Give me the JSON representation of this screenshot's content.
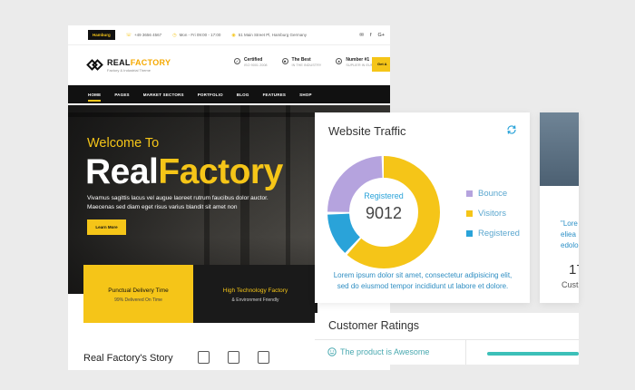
{
  "site": {
    "topbar": {
      "location": "Hamburg",
      "phone": "+49 3656 4567",
      "hours": "Mon - Fri 09:00 - 17:00",
      "address": "51 Main Street Pl, Hamburg Germany",
      "social": [
        "✉",
        "f",
        "G+"
      ]
    },
    "brand": {
      "real": "REAL",
      "factory": "FACTORY",
      "tagline": "Factory & Industrial Theme"
    },
    "header_info": [
      {
        "title": "Certified",
        "sub": "ISO 9001 2008"
      },
      {
        "title": "The Best",
        "sub": "IN THE INDUSTRY"
      },
      {
        "title": "Number #1",
        "sub": "SUPLIER IN EUROPE"
      }
    ],
    "get_quote": "Get A",
    "nav": [
      "HOME",
      "PAGES",
      "MARKET SECTORS",
      "PORTFOLIO",
      "BLOG",
      "FEATURES",
      "SHOP"
    ],
    "hero": {
      "welcome": "Welcome To",
      "title_white": "Real",
      "title_yellow": "Factory",
      "desc_line1": "Vivamus sagittis lacus vel augue laoreet rutrum faucibus dolor auctor.",
      "desc_line2": "Maecenas sed diam eget risus varius blandit sit amet non",
      "button": "Learn More"
    },
    "features": [
      {
        "title": "Punctual Delivery Time",
        "sub": "99% Delivered On Time"
      },
      {
        "title": "High Technology Factory",
        "sub": "& Environment Friendly"
      }
    ],
    "story_title": "Real Factory's Story"
  },
  "traffic": {
    "title": "Website Traffic",
    "center_label": "Registered",
    "center_value": "9012",
    "legend": [
      {
        "label": "Bounce",
        "color": "#b5a3de"
      },
      {
        "label": "Visitors",
        "color": "#f5c518"
      },
      {
        "label": "Registered",
        "color": "#2aa3d9"
      }
    ],
    "desc_line1": "Lorem ipsum dolor sit amet, consectetur adipisicing elit,",
    "desc_line2": "sed do eiusmod tempor incididunt ut labore et dolore.",
    "segments": [
      {
        "label": "Visitors",
        "fraction": 0.62,
        "color": "#f5c518"
      },
      {
        "label": "Registered",
        "fraction": 0.13,
        "color": "#2aa3d9"
      },
      {
        "label": "Bounce",
        "fraction": 0.25,
        "color": "#b5a3de"
      }
    ]
  },
  "side": {
    "quote_line1": "\"Lore",
    "quote_line2": "eliea",
    "quote_line3": "edolo",
    "number": "17",
    "caption": "Cust"
  },
  "ratings": {
    "title": "Customer Ratings",
    "item": "The product is Awesome"
  }
}
